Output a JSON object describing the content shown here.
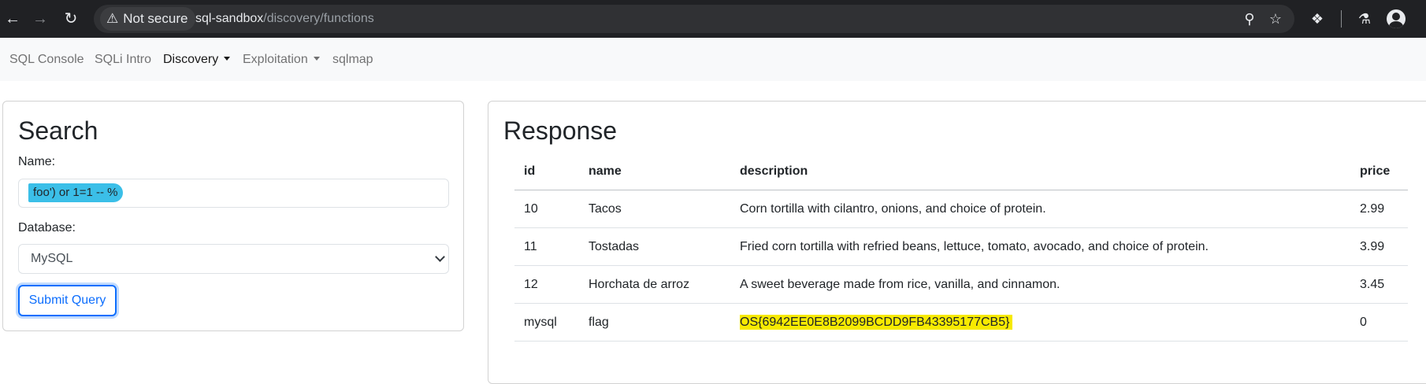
{
  "browser": {
    "security_label": "Not secure",
    "url_host": "sql-sandbox",
    "url_path": "/discovery/functions"
  },
  "nav": {
    "items": [
      {
        "label": "SQL Console"
      },
      {
        "label": "SQLi Intro"
      },
      {
        "label": "Discovery"
      },
      {
        "label": "Exploitation"
      },
      {
        "label": "sqlmap"
      }
    ],
    "active": "Discovery"
  },
  "search": {
    "title": "Search",
    "name_label": "Name:",
    "name_value": "foo') or 1=1 -- %",
    "database_label": "Database:",
    "database_selected": "MySQL",
    "submit_label": "Submit Query"
  },
  "response": {
    "title": "Response",
    "columns": [
      "id",
      "name",
      "description",
      "price"
    ],
    "rows": [
      [
        "10",
        "Tacos",
        "Corn tortilla with cilantro, onions, and choice of protein.",
        "2.99"
      ],
      [
        "11",
        "Tostadas",
        "Fried corn tortilla with refried beans, lettuce, tomato, avocado, and choice of protein.",
        "3.99"
      ],
      [
        "12",
        "Horchata de arroz",
        "A sweet beverage made from rice, vanilla, and cinnamon.",
        "3.45"
      ],
      [
        "mysql",
        "flag",
        "OS{6942EE0E8B2099BCDD9FB43395177CB5}",
        "0"
      ]
    ]
  },
  "colors": {
    "input_highlight": "#3bbfe8",
    "flag_highlight": "#f7ea00",
    "primary": "#0d6efd"
  }
}
